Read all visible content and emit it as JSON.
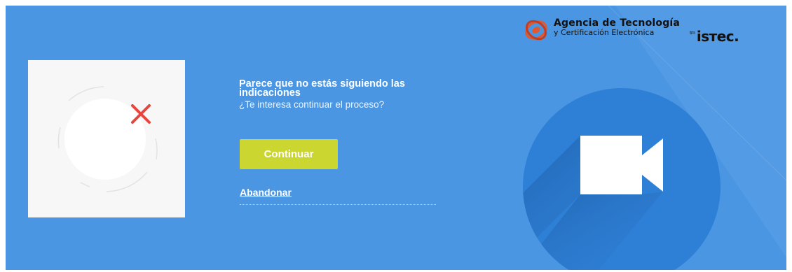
{
  "logo": {
    "line1": "Agencia de Tecnología",
    "line2": "y Certificación Electrónica",
    "tm": "tm",
    "brand": "isтec.",
    "mark_icon": "accv-logo-icon"
  },
  "message": {
    "title": "Parece que no estás siguiendo las indicaciones",
    "subtitle": "¿Te interesa continuar el proceso?"
  },
  "actions": {
    "continue_label": "Continuar",
    "abandon_label": "Abandonar"
  },
  "icons": {
    "error": "close-x-icon",
    "camera": "video-camera-icon",
    "face_guide": "face-guide-icon"
  },
  "colors": {
    "background": "#4a96e3",
    "continue_button": "#ccd630",
    "error_mark": "#e8453c",
    "camera_circle": "#2e7fd6",
    "logo_accent": "#e4572e"
  }
}
